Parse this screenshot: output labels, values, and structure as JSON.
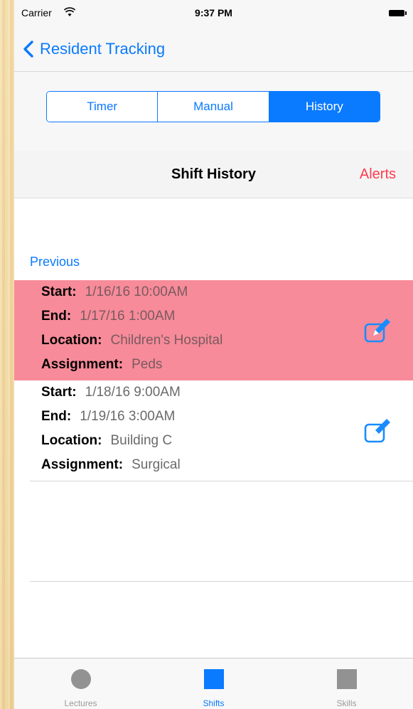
{
  "status_bar": {
    "carrier": "Carrier",
    "time": "9:37 PM"
  },
  "nav": {
    "back_label": "Resident Tracking"
  },
  "segments": [
    {
      "label": "Timer",
      "active": false
    },
    {
      "label": "Manual",
      "active": false
    },
    {
      "label": "History",
      "active": true
    }
  ],
  "header": {
    "title": "Shift History",
    "alerts_label": "Alerts"
  },
  "section": {
    "label": "Previous"
  },
  "field_labels": {
    "start": "Start:",
    "end": "End:",
    "location": "Location:",
    "assignment": "Assignment:"
  },
  "shifts": [
    {
      "start": "1/16/16 10:00AM",
      "end": "1/17/16 1:00AM",
      "location": "Children's Hospital",
      "assignment": "Peds",
      "highlighted": true
    },
    {
      "start": "1/18/16 9:00AM",
      "end": "1/19/16 3:00AM",
      "location": "Building C",
      "assignment": "Surgical",
      "highlighted": false
    }
  ],
  "tabs": [
    {
      "label": "Lectures",
      "icon": "circle-icon",
      "active": false
    },
    {
      "label": "Shifts",
      "icon": "square-icon",
      "active": true
    },
    {
      "label": "Skills",
      "icon": "square-icon",
      "active": false
    }
  ],
  "colors": {
    "accent": "#0a7aff",
    "alert": "#fe3b4f",
    "highlight_row": "#f78b99"
  }
}
